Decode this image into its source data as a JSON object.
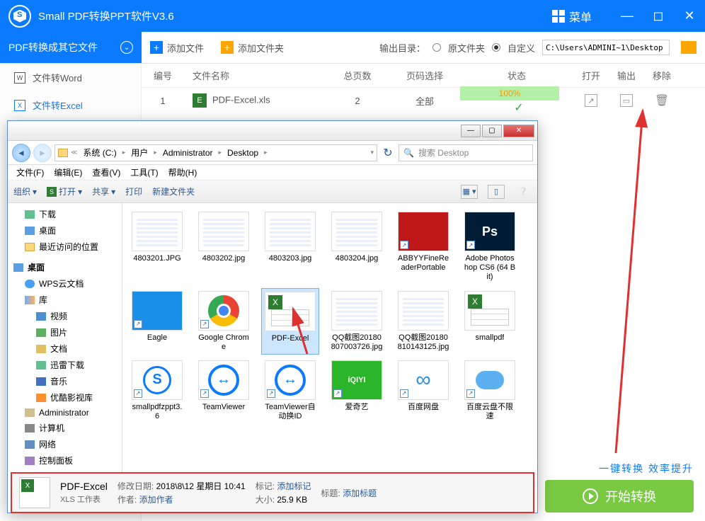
{
  "app": {
    "title": "Small  PDF转换PPT软件V3.6",
    "menu": "菜单"
  },
  "sidebar_header": "PDF转换成其它文件",
  "sidebar": {
    "items": [
      {
        "label": "文件转Word",
        "icon": "W"
      },
      {
        "label": "文件转Excel",
        "icon": "X",
        "active": true
      }
    ]
  },
  "toolbar": {
    "add_file": "添加文件",
    "add_folder": "添加文件夹",
    "output_label": "输出目录：",
    "opt_original": "原文件夹",
    "opt_custom": "自定义",
    "path": "C:\\Users\\ADMINI~1\\Desktop"
  },
  "table": {
    "headers": {
      "num": "编号",
      "name": "文件名称",
      "pages": "总页数",
      "range": "页码选择",
      "status": "状态",
      "open": "打开",
      "output": "输出",
      "remove": "移除"
    },
    "rows": [
      {
        "num": "1",
        "name": "PDF-Excel.xls",
        "pages": "2",
        "range": "全部",
        "status": "100%"
      }
    ]
  },
  "tagline": "一键转换  效率提升",
  "start": "开始转换",
  "dialog": {
    "breadcrumb": [
      "系统 (C:)",
      "用户",
      "Administrator",
      "Desktop"
    ],
    "search_placeholder": "搜索 Desktop",
    "menu": {
      "file": "文件(F)",
      "edit": "编辑(E)",
      "view": "查看(V)",
      "tools": "工具(T)",
      "help": "帮助(H)"
    },
    "tb": {
      "org": "组织",
      "open": "打开",
      "share": "共享",
      "print": "打印",
      "new": "新建文件夹"
    },
    "tree": [
      {
        "l": 1,
        "t": "下载",
        "i": "ico-dl"
      },
      {
        "l": 1,
        "t": "桌面",
        "i": "ico-desktop"
      },
      {
        "l": 1,
        "t": "最近访问的位置",
        "i": "ico-folder"
      },
      {
        "l": 0,
        "t": "桌面",
        "i": "ico-desktop"
      },
      {
        "l": 1,
        "t": "WPS云文档",
        "i": "ico-cloud"
      },
      {
        "l": 1,
        "t": "库",
        "i": "ico-lib"
      },
      {
        "l": 2,
        "t": "视频",
        "i": "ico-video"
      },
      {
        "l": 2,
        "t": "图片",
        "i": "ico-pic"
      },
      {
        "l": 2,
        "t": "文档",
        "i": "ico-doc"
      },
      {
        "l": 2,
        "t": "迅雷下载",
        "i": "ico-dl"
      },
      {
        "l": 2,
        "t": "音乐",
        "i": "ico-music"
      },
      {
        "l": 2,
        "t": "优酷影视库",
        "i": "ico-vk"
      },
      {
        "l": 1,
        "t": "Administrator",
        "i": "ico-user"
      },
      {
        "l": 1,
        "t": "计算机",
        "i": "ico-comp"
      },
      {
        "l": 1,
        "t": "网络",
        "i": "ico-net"
      },
      {
        "l": 1,
        "t": "控制面板",
        "i": "ico-ctrl"
      }
    ],
    "files": [
      {
        "name": "4803201.JPG",
        "type": "img"
      },
      {
        "name": "4803202.jpg",
        "type": "img"
      },
      {
        "name": "4803203.jpg",
        "type": "img"
      },
      {
        "name": "4803204.jpg",
        "type": "img"
      },
      {
        "name": "ABBYYFineReaderPortable",
        "type": "app",
        "color": "#c01818",
        "shortcut": true
      },
      {
        "name": "Adobe Photoshop CS6 (64 Bit)",
        "type": "app",
        "color": "#001d36",
        "txt": "Ps",
        "shortcut": true
      },
      {
        "name": "Eagle",
        "type": "app",
        "color": "#1a8fe8",
        "shortcut": true
      },
      {
        "name": "Google Chrome",
        "type": "app",
        "color": "#fff",
        "shortcut": true,
        "chrome": true
      },
      {
        "name": "PDF-Excel",
        "type": "xls",
        "selected": true
      },
      {
        "name": "QQ截图20180807003726.jpg",
        "type": "img"
      },
      {
        "name": "QQ截图20180810143125.jpg",
        "type": "img"
      },
      {
        "name": "smallpdf",
        "type": "xls"
      },
      {
        "name": "smallpdfzppt3.6",
        "type": "app",
        "color": "#fff",
        "shortcut": true,
        "logo": true
      },
      {
        "name": "TeamViewer",
        "type": "app",
        "color": "#fff",
        "shortcut": true,
        "tv": true
      },
      {
        "name": "TeamViewer自动换ID",
        "type": "app",
        "color": "#fff",
        "shortcut": true,
        "tv": true
      },
      {
        "name": "爱奇艺",
        "type": "app",
        "color": "#2bb52b",
        "txt": "iQIYI",
        "shortcut": true
      },
      {
        "name": "百度网盘",
        "type": "app",
        "color": "#fff",
        "shortcut": true,
        "baidu": true
      },
      {
        "name": "百度云盘不限速",
        "type": "app",
        "color": "#fff",
        "shortcut": true,
        "cloud": true
      }
    ],
    "details": {
      "name": "PDF-Excel",
      "type": "XLS 工作表",
      "mod_label": "修改日期:",
      "mod": "2018\\8\\12 星期日 10:41",
      "tag_label": "标记:",
      "tag": "添加标记",
      "title_label": "标题:",
      "title": "添加标题",
      "author_label": "作者:",
      "author": "添加作者",
      "size_label": "大小:",
      "size": "25.9 KB"
    }
  }
}
